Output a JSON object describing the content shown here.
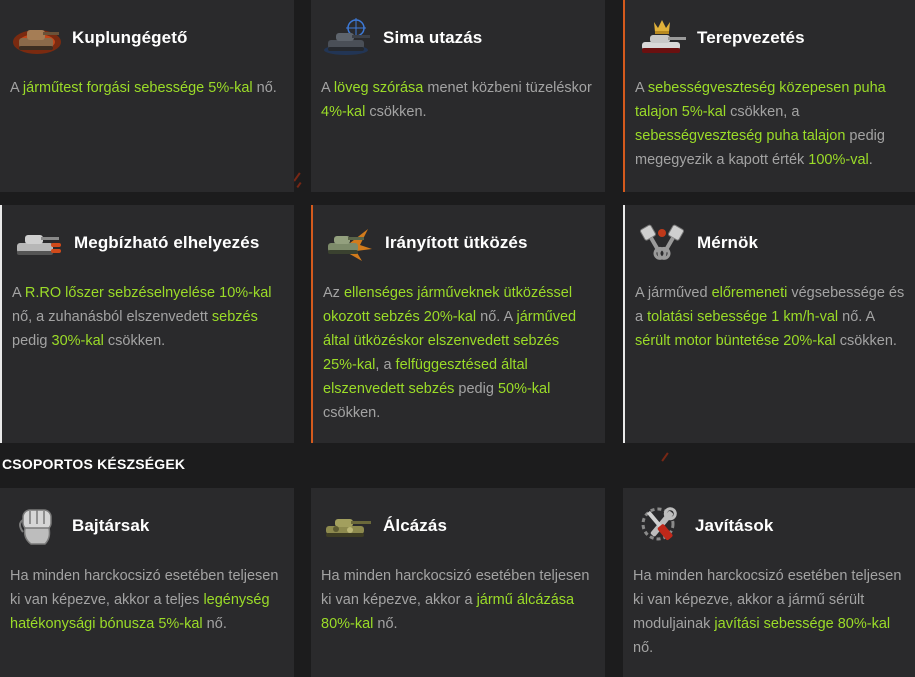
{
  "section": {
    "group_skills_title": "CSOPORTOS KÉSZSÉGEK"
  },
  "cards": [
    {
      "title": "Kuplungégető",
      "icon": "tank-burning-icon",
      "desc": [
        {
          "t": "A ",
          "h": false
        },
        {
          "t": "járműtest forgási sebessége 5%-kal",
          "h": true
        },
        {
          "t": " nő.",
          "h": false
        }
      ]
    },
    {
      "title": "Sima utazás",
      "icon": "tank-crosshair-icon",
      "desc": [
        {
          "t": "A ",
          "h": false
        },
        {
          "t": "löveg szórása",
          "h": true
        },
        {
          "t": " menet közbeni tüzeléskor ",
          "h": false
        },
        {
          "t": "4%-kal",
          "h": true
        },
        {
          "t": " csökken.",
          "h": false
        }
      ]
    },
    {
      "title": "Terepvezetés",
      "icon": "tank-crown-icon",
      "desc": [
        {
          "t": "A ",
          "h": false
        },
        {
          "t": "sebességveszteség közepesen puha talajon 5%-kal",
          "h": true
        },
        {
          "t": " csökken, a ",
          "h": false
        },
        {
          "t": "sebességveszteség puha talajon",
          "h": true
        },
        {
          "t": " pedig megegyezik a kapott érték ",
          "h": false
        },
        {
          "t": "100%-val",
          "h": true
        },
        {
          "t": ".",
          "h": false
        }
      ]
    },
    {
      "title": "Megbízható elhelyezés",
      "icon": "tank-ammo-icon",
      "desc": [
        {
          "t": "A ",
          "h": false
        },
        {
          "t": "R.RO lőszer sebzéselnyelése 10%-kal",
          "h": true
        },
        {
          "t": " nő, a zuhanásból elszenvedett ",
          "h": false
        },
        {
          "t": "sebzés",
          "h": true
        },
        {
          "t": " pedig ",
          "h": false
        },
        {
          "t": "30%-kal",
          "h": true
        },
        {
          "t": " csökken.",
          "h": false
        }
      ]
    },
    {
      "title": "Irányított ütközés",
      "icon": "tank-ram-icon",
      "desc": [
        {
          "t": "Az ",
          "h": false
        },
        {
          "t": "ellenséges járműveknek ütközéssel okozott sebzés 20%-kal",
          "h": true
        },
        {
          "t": " nő. A ",
          "h": false
        },
        {
          "t": "járműved által ütközéskor elszenvedett sebzés 25%-kal",
          "h": true
        },
        {
          "t": ", a ",
          "h": false
        },
        {
          "t": "felfüggesztésed által elszenvedett sebzés",
          "h": true
        },
        {
          "t": " pedig ",
          "h": false
        },
        {
          "t": "50%-kal",
          "h": true
        },
        {
          "t": " csökken.",
          "h": false
        }
      ]
    },
    {
      "title": "Mérnök",
      "icon": "pistons-icon",
      "desc": [
        {
          "t": "A járműved ",
          "h": false
        },
        {
          "t": "előremeneti",
          "h": true
        },
        {
          "t": " végsebessége és a ",
          "h": false
        },
        {
          "t": "tolatási sebessége 1 km/h-val",
          "h": true
        },
        {
          "t": " nő. A ",
          "h": false
        },
        {
          "t": "sérült motor büntetése 20%-kal",
          "h": true
        },
        {
          "t": " csökken.",
          "h": false
        }
      ]
    },
    {
      "title": "Bajtársak",
      "icon": "fist-icon",
      "desc": [
        {
          "t": "Ha minden harckocsizó esetében teljesen ki van képezve, akkor a teljes ",
          "h": false
        },
        {
          "t": "legénység hatékonysági bónusza 5%-kal",
          "h": true
        },
        {
          "t": " nő.",
          "h": false
        }
      ]
    },
    {
      "title": "Álcázás",
      "icon": "tank-camo-icon",
      "desc": [
        {
          "t": "Ha minden harckocsizó esetében teljesen ki van képezve, akkor a ",
          "h": false
        },
        {
          "t": "jármű álcázása 80%-kal",
          "h": true
        },
        {
          "t": " nő.",
          "h": false
        }
      ]
    },
    {
      "title": "Javítások",
      "icon": "wrench-screwdriver-icon",
      "desc": [
        {
          "t": "Ha minden harckocsizó esetében teljesen ki van képezve, akkor a jármű sérült moduljainak ",
          "h": false
        },
        {
          "t": "javítási sebessége 80%-kal",
          "h": true
        },
        {
          "t": " nő.",
          "h": false
        }
      ]
    }
  ],
  "colors": {
    "highlight": "#9bdc28",
    "text": "#a3a3a3",
    "card_bg": "#2a2a2c",
    "page_bg": "#1c1c1d",
    "accent_orange": "#d45a1d",
    "accent_white": "#e9e9e9"
  }
}
